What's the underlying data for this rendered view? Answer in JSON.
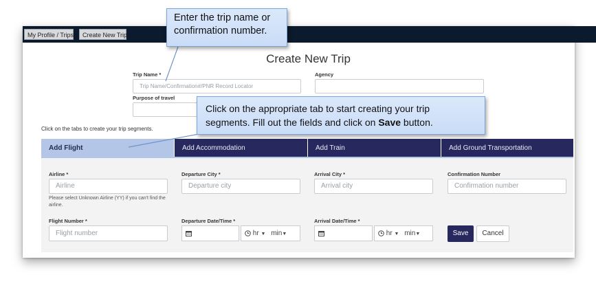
{
  "nav": {
    "profile_trips": "My Profile / Trips",
    "create_new_trip": "Create New Trip"
  },
  "page_title": "Create New Trip",
  "trip": {
    "name_label": "Trip Name *",
    "name_placeholder": "Trip Name/Confirmation#/PNR Record Locator",
    "agency_label": "Agency",
    "agency_value": "",
    "purpose_label": "Purpose of travel",
    "purpose_value": ""
  },
  "segments_hint": "Click on the tabs to create your trip segments.",
  "tabs": [
    {
      "label": "Add Flight",
      "active": true
    },
    {
      "label": "Add Accommodation",
      "active": false
    },
    {
      "label": "Add Train",
      "active": false
    },
    {
      "label": "Add Ground Transportation",
      "active": false
    }
  ],
  "flight": {
    "airline_label": "Airline *",
    "airline_placeholder": "Airline",
    "airline_note": "Please select Unknown Airline (YY) if you can't find the airline.",
    "departure_city_label": "Departure City *",
    "departure_city_placeholder": "Departure city",
    "arrival_city_label": "Arrival City *",
    "arrival_city_placeholder": "Arrival city",
    "confirmation_label": "Confirmation Number",
    "confirmation_placeholder": "Confirmation number",
    "flight_number_label": "Flight Number *",
    "flight_number_placeholder": "Flight number",
    "departure_dt_label": "Departure Date/Time *",
    "arrival_dt_label": "Arrival Date/Time *",
    "hr_label": "hr",
    "min_label": "min",
    "save_label": "Save",
    "cancel_label": "Cancel"
  },
  "callouts": {
    "one": "Enter the trip name or confirmation number.",
    "two_prefix": "Click on the appropriate tab to start creating your trip segments. Fill out the fields and click on ",
    "two_bold": "Save",
    "two_suffix": " button."
  },
  "icons": {
    "calendar": "calendar-icon",
    "clock": "clock-icon",
    "caret": "caret-down-icon"
  },
  "colors": {
    "topbar": "#0b1a2c",
    "tab_dark": "#26285e",
    "tab_active": "#b4c6e7",
    "callout_bg": "#dbe8fb"
  }
}
